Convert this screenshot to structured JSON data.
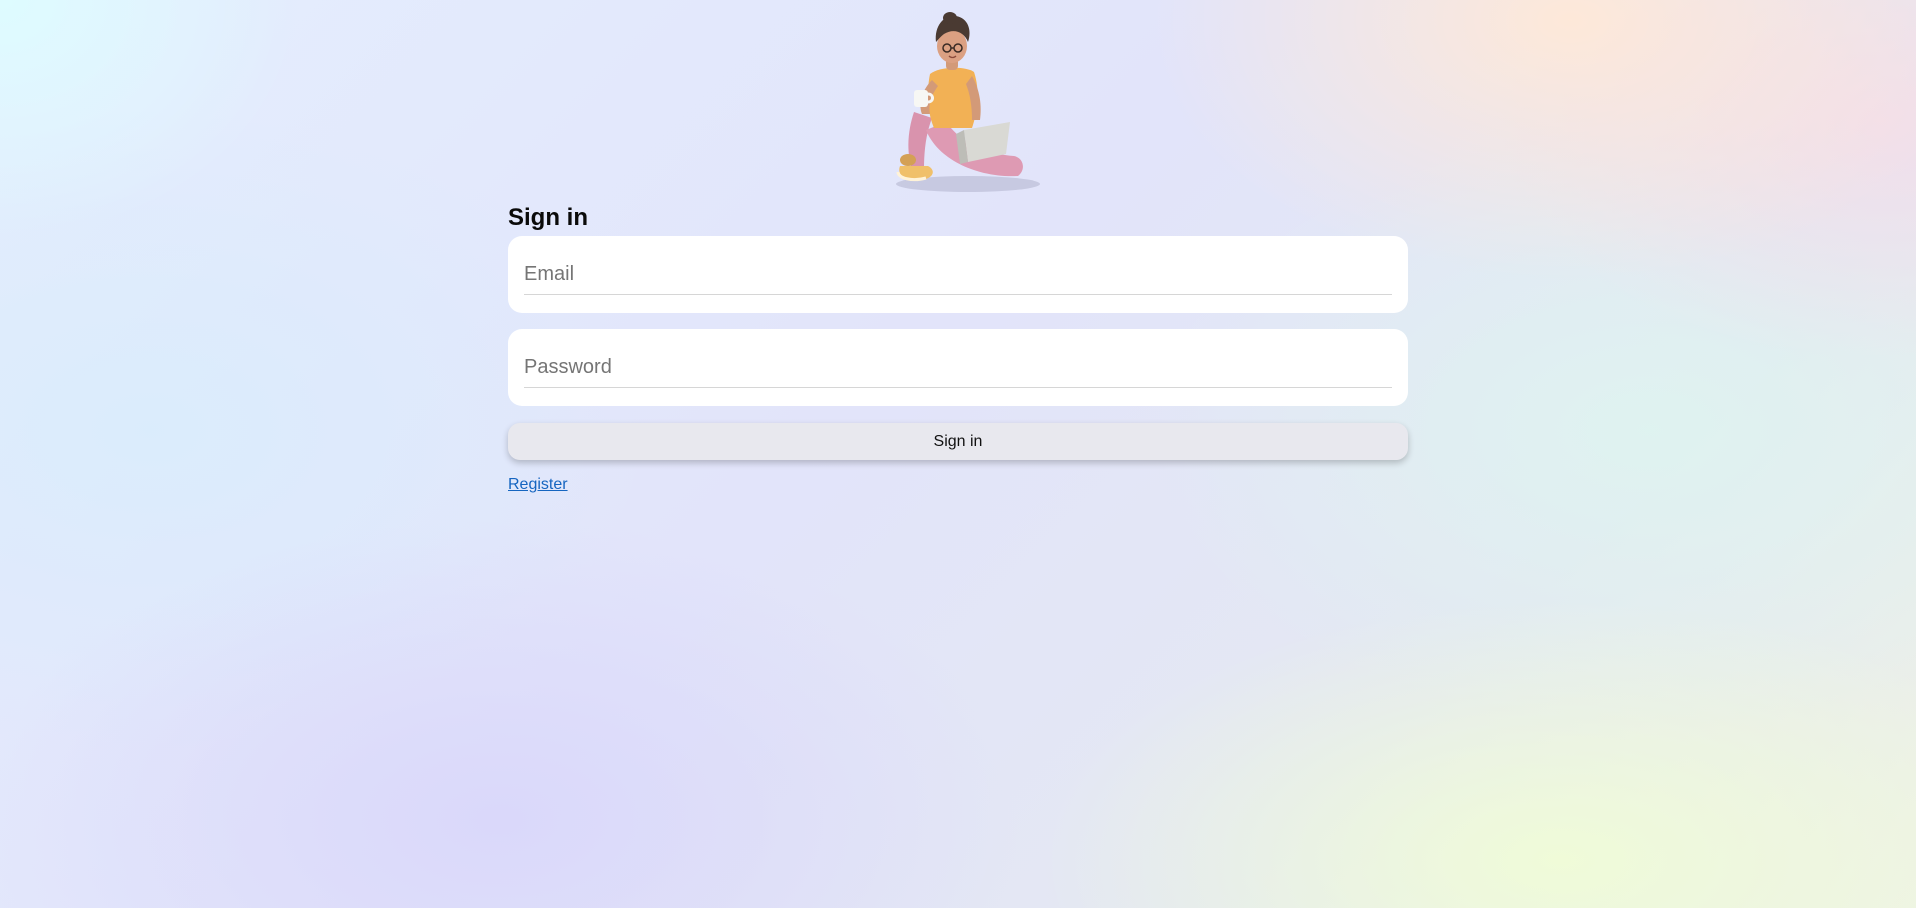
{
  "hero": {
    "illustration": "person-sitting-with-laptop-and-cup"
  },
  "form": {
    "title": "Sign in",
    "email_placeholder": "Email",
    "password_placeholder": "Password",
    "submit_label": "Sign in",
    "register_label": "Register"
  },
  "colors": {
    "link": "#1565c0",
    "button_bg": "#e8e8ee",
    "field_bg": "#ffffff"
  }
}
